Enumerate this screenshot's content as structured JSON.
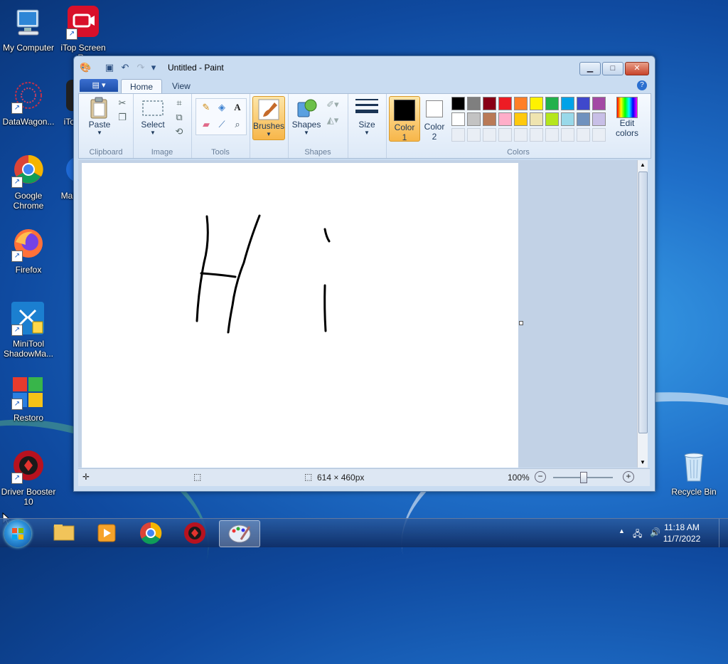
{
  "desktop": {
    "icons": [
      {
        "label": "My Computer"
      },
      {
        "label": "iTop Screen Re"
      },
      {
        "label": "DataWagon..."
      },
      {
        "label": "iTo"
      },
      {
        "label": "Google Chrome"
      },
      {
        "label": "Mal"
      },
      {
        "label": "Firefox"
      },
      {
        "label": "MiniTool ShadowMa..."
      },
      {
        "label": "Restoro"
      },
      {
        "label": "Driver Booster 10"
      },
      {
        "label": "Recycle Bin"
      }
    ]
  },
  "window": {
    "title": "Untitled - Paint",
    "tabs": [
      {
        "label": "Home"
      },
      {
        "label": "View"
      }
    ],
    "help_label": "?",
    "ribbon": {
      "clipboard": {
        "label": "Clipboard",
        "paste": "Paste"
      },
      "image": {
        "label": "Image",
        "select": "Select"
      },
      "tools": {
        "label": "Tools"
      },
      "brushes": {
        "label": "Brushes"
      },
      "shapes": {
        "label": "Shapes",
        "shapes_btn": "Shapes"
      },
      "size": {
        "label": "Size"
      },
      "color1": {
        "label": "Color 1",
        "line1": "Color",
        "line2": "1",
        "value": "#000000"
      },
      "color2": {
        "label": "Color 2",
        "line1": "Color",
        "line2": "2",
        "value": "#ffffff"
      },
      "colors": {
        "label": "Colors",
        "row1": [
          "#000000",
          "#7f7f7f",
          "#880015",
          "#ed1c24",
          "#ff7f27",
          "#fff200",
          "#22b14c",
          "#00a2e8",
          "#3f48cc",
          "#a349a4"
        ],
        "row2": [
          "#ffffff",
          "#c3c3c3",
          "#b97a57",
          "#ffaec9",
          "#ffc90e",
          "#efe4b0",
          "#b5e61d",
          "#99d9ea",
          "#7092be",
          "#c8bfe7"
        ]
      },
      "edit_colors": {
        "line1": "Edit",
        "line2": "colors"
      }
    },
    "status": {
      "canvas_size": "614 × 460px",
      "zoom": "100%"
    }
  },
  "taskbar": {
    "time": "11:18 AM",
    "date": "11/7/2022"
  }
}
